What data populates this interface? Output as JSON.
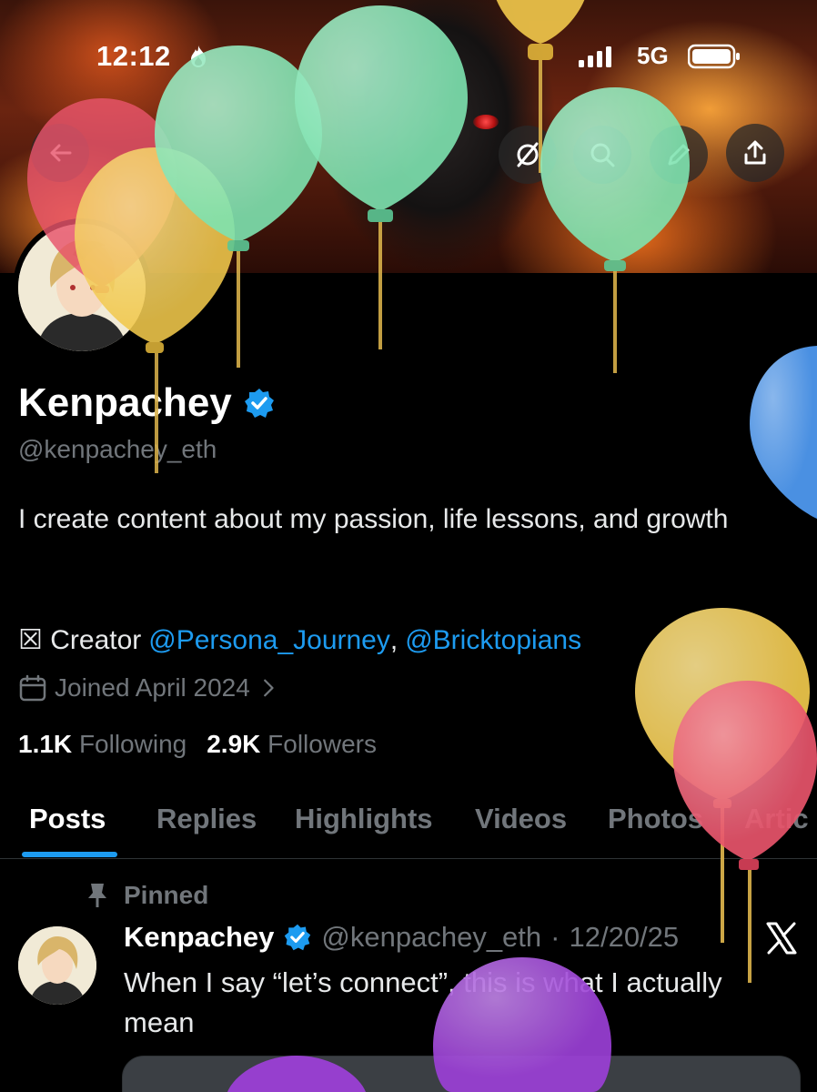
{
  "status_bar": {
    "time": "12:12",
    "network": "5G",
    "icons": [
      "flame-icon",
      "signal-icon",
      "battery-icon"
    ]
  },
  "header": {
    "buttons": [
      "back-arrow-icon",
      "grok-icon",
      "search-icon",
      "edit-icon",
      "share-icon"
    ]
  },
  "profile": {
    "name": "Kenpachey",
    "handle": "@kenpachey_eth",
    "bio": "I create content about my passion, life lessons, and growth",
    "creator_prefix": "☒ Creator",
    "creator_link_1": "@Persona_Journey",
    "creator_sep": ",",
    "creator_link_2": "@Bricktopians",
    "joined": "Joined April 2024",
    "following_count": "1.1K",
    "following_label": "Following",
    "followers_count": "2.9K",
    "followers_label": "Followers"
  },
  "tabs": [
    {
      "label": "Posts",
      "active": true
    },
    {
      "label": "Replies",
      "active": false
    },
    {
      "label": "Highlights",
      "active": false
    },
    {
      "label": "Videos",
      "active": false
    },
    {
      "label": "Photos",
      "active": false
    },
    {
      "label": "Artic",
      "active": false
    }
  ],
  "pinned_post": {
    "pinned_label": "Pinned",
    "author_name": "Kenpachey",
    "author_handle": "@kenpachey_eth",
    "separator": "·",
    "date": "12/20/25",
    "text": "When I say “let’s connect”, this is what I actually mean"
  },
  "colors": {
    "accent": "#1d9bf0",
    "muted": "#71767b",
    "background": "#000000",
    "balloon_green": "#7ee3b0",
    "balloon_yellow": "#f2c94c",
    "balloon_red": "#e8546b",
    "balloon_blue": "#4a90e2",
    "balloon_purple": "#9b3fd6"
  }
}
